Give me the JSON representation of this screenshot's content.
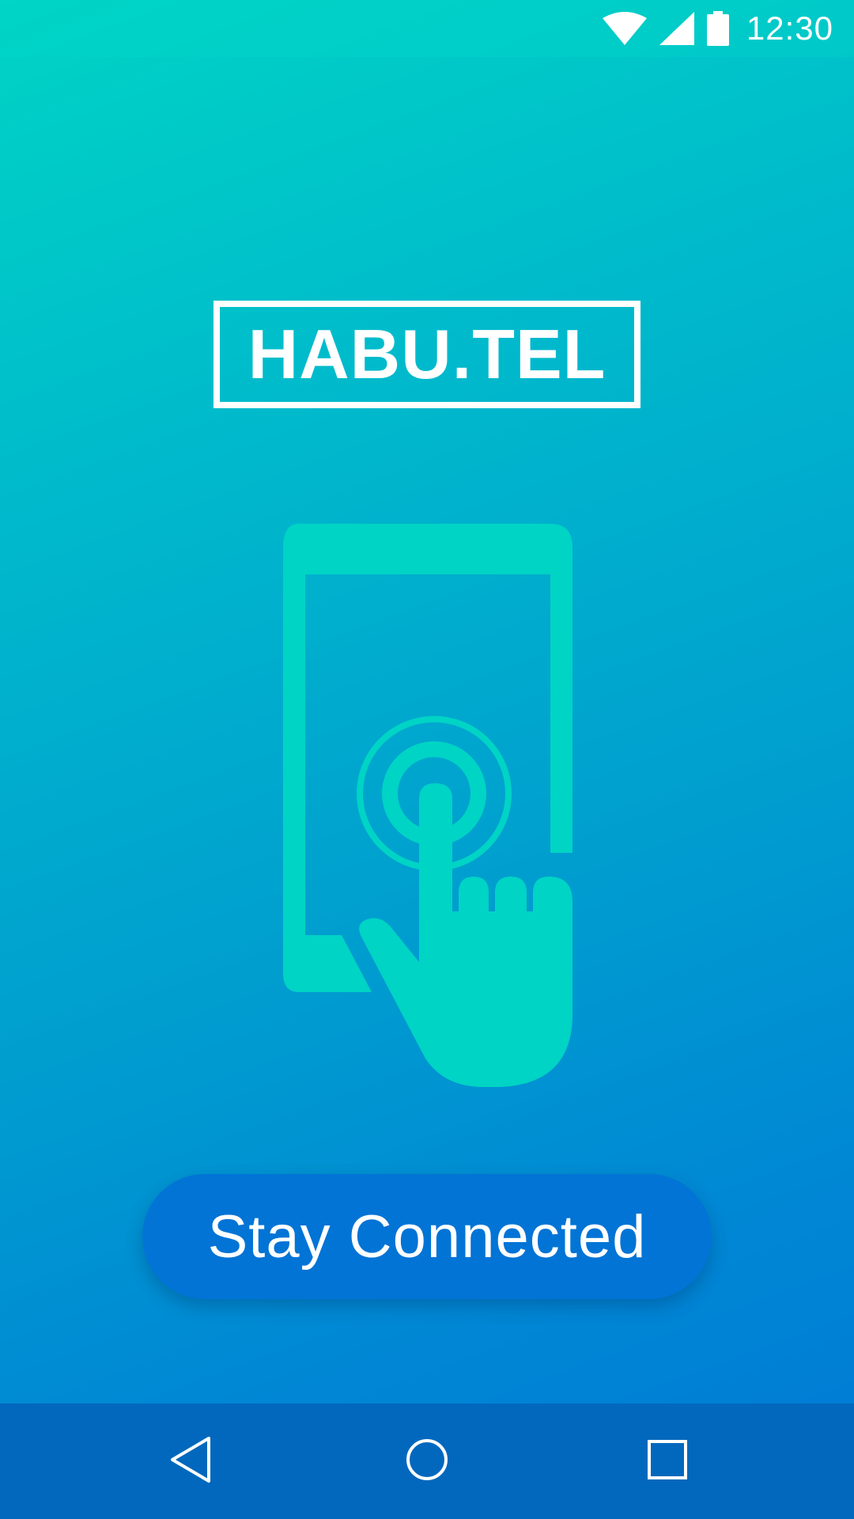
{
  "status_bar": {
    "time": "12:30",
    "icons": [
      "wifi-icon",
      "signal-icon",
      "battery-icon"
    ]
  },
  "logo": {
    "text": "HABU.TEL"
  },
  "illustration": {
    "icon": "phone-tap-icon",
    "color": "#00d4c5"
  },
  "cta": {
    "label": "Stay Connected",
    "color": "#0274d6"
  },
  "nav_bar": {
    "icons": [
      "back-icon",
      "home-icon",
      "recents-icon"
    ],
    "color": "#0268bd"
  },
  "colors": {
    "gradient_top": "#00d4c5",
    "gradient_bottom": "#0079d6",
    "text": "#ffffff"
  }
}
